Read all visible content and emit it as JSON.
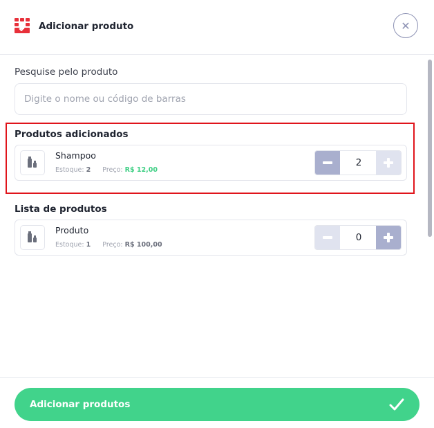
{
  "header": {
    "title": "Adicionar produto",
    "brand_icon": "shop-icon",
    "brand_color": "#e8303a",
    "close_icon": "close-icon"
  },
  "search": {
    "label": "Pesquise pelo produto",
    "placeholder": "Digite o nome ou código de barras",
    "value": ""
  },
  "added_section": {
    "title": "Produtos adicionados",
    "highlight_color": "#e0141b",
    "items": [
      {
        "name": "Shampoo",
        "stock_label": "Estoque:",
        "stock_value": "2",
        "price_label": "Preço:",
        "price_value": "R$ 12,00",
        "quantity": "2",
        "icon": "bottles-icon"
      }
    ]
  },
  "list_section": {
    "title": "Lista de produtos",
    "items": [
      {
        "name": "Produto",
        "stock_label": "Estoque:",
        "stock_value": "1",
        "price_label": "Preço:",
        "price_value": "R$ 100,00",
        "quantity": "0",
        "icon": "bottles-icon"
      }
    ]
  },
  "footer": {
    "submit_label": "Adicionar produtos",
    "submit_icon": "check-icon",
    "submit_color": "#41d38b"
  }
}
